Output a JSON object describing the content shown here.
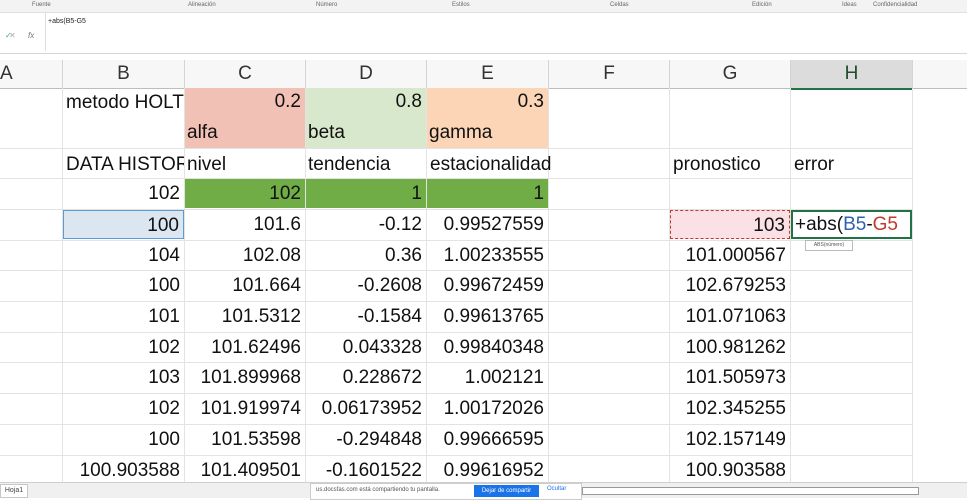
{
  "ribbon": {
    "groups": [
      "Fuente",
      "Alineación",
      "Número",
      "Estilos",
      "Celdas",
      "Edición",
      "Ideas",
      "Confidencialidad"
    ]
  },
  "formula_bar": {
    "cancel_icon": "✕",
    "enter_icon": "✓",
    "fx_label": "fx",
    "content": "+abs(B5-G5"
  },
  "columns": [
    "A",
    "B",
    "C",
    "D",
    "E",
    "F",
    "G",
    "H"
  ],
  "selected_column": "H",
  "row1": {
    "B": "metodo HOLT",
    "C_value": "0.2",
    "C_label": "alfa",
    "D_value": "0.8",
    "D_label": "beta",
    "E_value": "0.3",
    "E_label": "gamma"
  },
  "headers": {
    "B": "DATA HISTORICA",
    "C": "nivel",
    "D": "tendencia",
    "E": "estacionalidad",
    "G": "pronostico",
    "H": "error"
  },
  "rows": [
    {
      "B": "102",
      "C": "102",
      "D": "1",
      "E": "1",
      "G": "",
      "H": ""
    },
    {
      "B": "100",
      "C": "101.6",
      "D": "-0.12",
      "E": "0.99527559",
      "G": "103",
      "H": ""
    },
    {
      "B": "104",
      "C": "102.08",
      "D": "0.36",
      "E": "1.00233555",
      "G": "101.000567",
      "H": ""
    },
    {
      "B": "100",
      "C": "101.664",
      "D": "-0.2608",
      "E": "0.99672459",
      "G": "102.679253",
      "H": ""
    },
    {
      "B": "101",
      "C": "101.5312",
      "D": "-0.1584",
      "E": "0.99613765",
      "G": "101.071063",
      "H": ""
    },
    {
      "B": "102",
      "C": "101.62496",
      "D": "0.043328",
      "E": "0.99840348",
      "G": "100.981262",
      "H": ""
    },
    {
      "B": "103",
      "C": "101.899968",
      "D": "0.228672",
      "E": "1.002121",
      "G": "101.505973",
      "H": ""
    },
    {
      "B": "102",
      "C": "101.919974",
      "D": "0.06173952",
      "E": "1.00172026",
      "G": "102.345255",
      "H": ""
    },
    {
      "B": "100",
      "C": "101.53598",
      "D": "-0.294848",
      "E": "0.99666595",
      "G": "102.157149",
      "H": ""
    },
    {
      "B": "100.903588",
      "C": "101.409501",
      "D": "-0.1601522",
      "E": "0.99616952",
      "G": "100.903588",
      "H": ""
    }
  ],
  "edit_cell": {
    "prefix": "+abs(",
    "ref1": "B5",
    "op": "-",
    "ref2": "G5",
    "tooltip": "ABS(número)"
  },
  "status": {
    "sheet_tab": "Hoja1",
    "share_message": "us.docsfas.com está compartiendo tu pantalla.",
    "share_button": "Dejar de compartir",
    "hide_link": "Ocultar"
  },
  "colors": {
    "alfa_fill": "#f2c1b6",
    "beta_fill": "#d7e8cc",
    "gamma_fill": "#fbd5b5",
    "init_row_fill": "#70ad47",
    "selected_cell_fill": "#dce6f1",
    "ref_b_color": "#2f5fb3",
    "ref_g_color": "#c0392b"
  }
}
